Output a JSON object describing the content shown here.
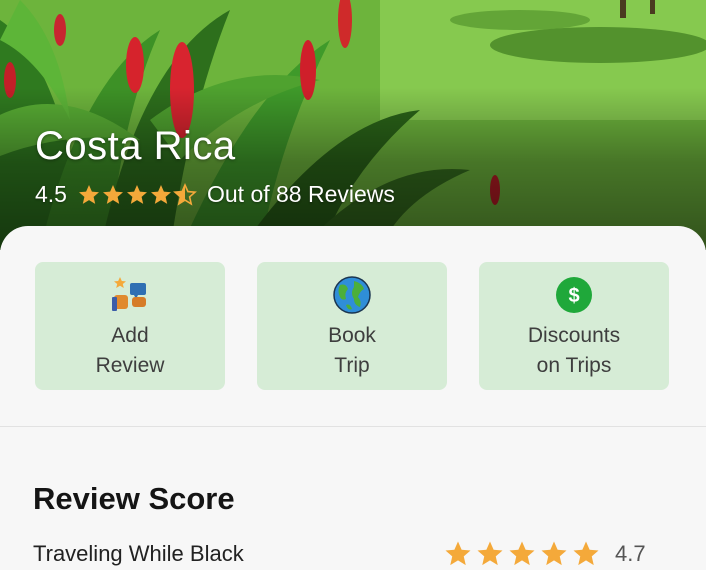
{
  "hero": {
    "title": "Costa Rica",
    "rating": "4.5",
    "rating_value": 4.5,
    "reviews_text": "Out of 88 Reviews"
  },
  "actions": [
    {
      "label": "Add\nReview",
      "icon": "add-review-icon"
    },
    {
      "label": "Book\nTrip",
      "icon": "globe-icon"
    },
    {
      "label": "Discounts\non Trips",
      "icon": "dollar-coin-icon"
    }
  ],
  "review_score": {
    "title": "Review Score",
    "rows": [
      {
        "label": "Traveling While Black",
        "value": "4.7",
        "stars": 5
      }
    ]
  },
  "colors": {
    "star": "#f4a93a",
    "card_bg": "#d6ecd6",
    "coin": "#1fa83a"
  }
}
